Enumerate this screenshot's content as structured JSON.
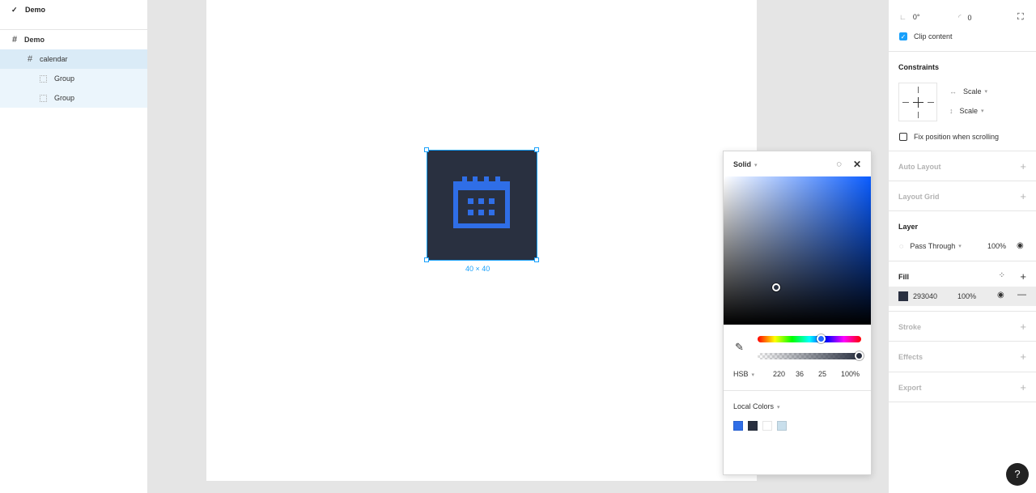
{
  "left": {
    "page_name": "Demo",
    "layers": [
      {
        "name": "Demo",
        "kind": "frame"
      },
      {
        "name": "calendar",
        "kind": "frame-selected"
      },
      {
        "name": "Group",
        "kind": "group"
      },
      {
        "name": "Group",
        "kind": "group"
      }
    ]
  },
  "canvas": {
    "size_label": "40 × 40",
    "frame_color": "#293040",
    "icon_color": "#2f6ee7"
  },
  "picker": {
    "mode": "Solid",
    "hue_percent": 61,
    "alpha_percent": 100,
    "model": "HSB",
    "h": "220",
    "s": "36",
    "b": "25",
    "a": "100%",
    "local_colors_label": "Local Colors",
    "swatches": [
      "#2f6ee7",
      "#293040",
      "#ffffff",
      "#c9dfec"
    ]
  },
  "right": {
    "rotation": "0°",
    "radius": "0",
    "clip_content": "Clip content",
    "constraints_title": "Constraints",
    "constraint_h": "Scale",
    "constraint_v": "Scale",
    "fix_position": "Fix position when scrolling",
    "auto_layout": "Auto Layout",
    "layout_grid": "Layout Grid",
    "layer_title": "Layer",
    "blend": "Pass Through",
    "layer_opacity": "100%",
    "fill_title": "Fill",
    "fill_hex": "293040",
    "fill_opacity": "100%",
    "stroke": "Stroke",
    "effects": "Effects",
    "export": "Export",
    "help": "?"
  }
}
